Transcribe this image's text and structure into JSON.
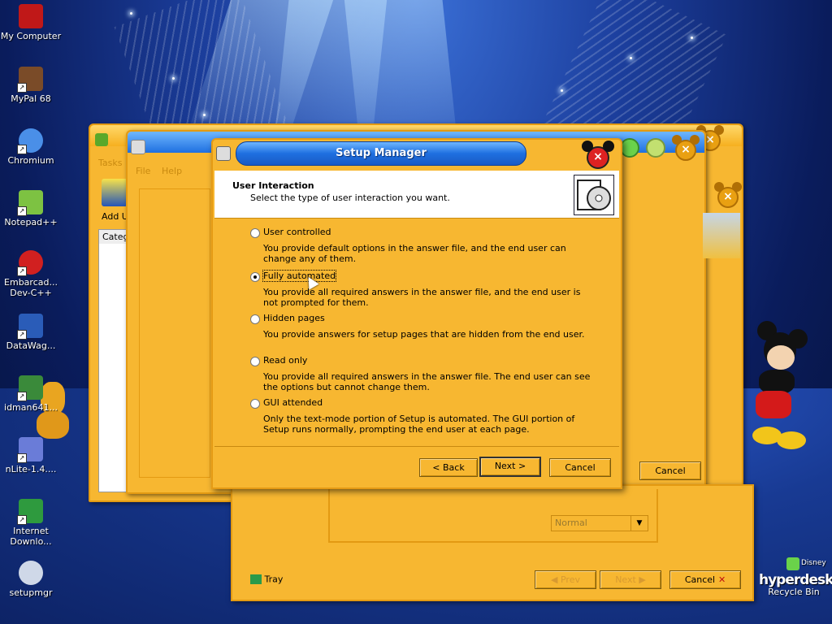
{
  "desktop_icons": [
    {
      "label": "My Computer",
      "icon": "my-computer-icon",
      "color": "#c01818"
    },
    {
      "label": "MyPal 68",
      "icon": "mypal-icon",
      "color": "#7a4b28"
    },
    {
      "label": "Chromium",
      "icon": "chromium-icon",
      "color": "#4a8fe8"
    },
    {
      "label": "Notepad++",
      "icon": "notepad-icon",
      "color": "#7dc242"
    },
    {
      "label": "Embarcad... Dev-C++",
      "icon": "devcpp-icon",
      "color": "#d12020"
    },
    {
      "label": "DataWag...",
      "icon": "datawag-icon",
      "color": "#2a5cb8"
    },
    {
      "label": "idman641...",
      "icon": "idm-icon",
      "color": "#3a8a3a"
    },
    {
      "label": "nLite-1.4....",
      "icon": "nlite-icon",
      "color": "#6a7cd8"
    },
    {
      "label": "Internet Downlo...",
      "icon": "idm-download-icon",
      "color": "#2e9a3e"
    },
    {
      "label": "setupmgr",
      "icon": "setupmgr-icon",
      "color": "#cfd8e8"
    }
  ],
  "recycle_bin": {
    "label": "Recycle Bin",
    "brand": "hyperdesk",
    "brand_small": "Disney"
  },
  "back_window_1": {
    "menu_file": "File",
    "menu_help": "Help",
    "tasks": "Tasks",
    "add_label": "Add UI",
    "category": "Categ"
  },
  "back_window_2": {
    "cancel": "Cancel"
  },
  "bottom_window": {
    "tray": "Tray",
    "prev": "Prev",
    "next": "Next",
    "cancel": "Cancel",
    "select_value": "Normal"
  },
  "setup": {
    "title": "Setup Manager",
    "header_title": "User Interaction",
    "header_subtitle": "Select the type of user interaction you want.",
    "options": [
      {
        "label": "User controlled",
        "description": "You provide default options in the answer file, and the end user can change any of them.",
        "selected": false
      },
      {
        "label": "Fully automated",
        "description": "You provide all required answers in the answer file, and the end user is not prompted for them.",
        "selected": true
      },
      {
        "label": "Hidden pages",
        "description": "You provide answers for setup pages that are hidden from  the end user.",
        "selected": false
      },
      {
        "label": "Read only",
        "description": "You provide all required answers in the answer file. The end user can see the options but cannot change them.",
        "selected": false
      },
      {
        "label": "GUI attended",
        "description": "Only the text-mode portion of Setup is automated. The GUI portion of Setup runs normally, prompting the end user at each page.",
        "selected": false
      }
    ],
    "back": "< Back",
    "next": "Next >",
    "cancel": "Cancel"
  },
  "colors": {
    "window_body": "#f7b731",
    "title_blue": "#1e6fe0",
    "desktop": "#1c3f9e"
  }
}
